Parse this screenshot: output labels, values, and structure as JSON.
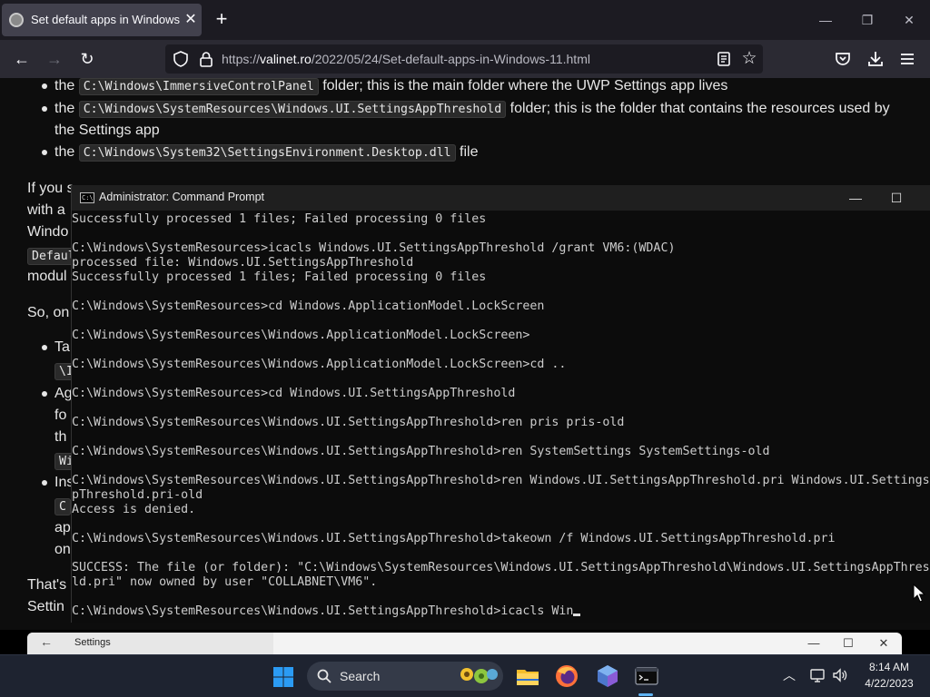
{
  "browser": {
    "tab": {
      "title": "Set default apps in Windows 11",
      "close_glyph": "✕"
    },
    "new_tab_glyph": "+",
    "window_controls": {
      "minimize": "—",
      "restore": "❐",
      "close": "✕"
    },
    "nav": {
      "back": "←",
      "forward": "→",
      "reload": "↻"
    },
    "url": {
      "host": "valinet.ro",
      "prefix": "https://",
      "path": "/2022/05/24/Set-default-apps-in-Windows-11.html"
    },
    "star": "☆"
  },
  "page": {
    "bullets": [
      {
        "pre": "the ",
        "code": "C:\\Windows\\ImmersiveControlPanel",
        "post": " folder; this is the main folder where the UWP Settings app lives"
      },
      {
        "pre": "the ",
        "code": "C:\\Windows\\SystemResources\\Windows.UI.SettingsAppThreshold",
        "post": " folder; this is the folder that contains the resources used by"
      },
      {
        "cont": "the Settings app"
      },
      {
        "pre": "the ",
        "code": "C:\\Windows\\System32\\SettingsEnvironment.Desktop.dll",
        "post": " file"
      }
    ],
    "fragments": {
      "if_you": "If you s",
      "with_a": "with a",
      "windo": "Windo",
      "defaul": "Defaul",
      "modul": "modul",
      "so_on": "So, on",
      "ta": "Ta",
      "code_i": "\\I",
      "ag": "Ag",
      "fo": "fo",
      "th": "th",
      "code_w": "Wi",
      "ins": "Ins",
      "code_c": "C",
      "ap": "ap",
      "on": "on",
      "thats": "That's",
      "settin": "Settin"
    }
  },
  "cmd": {
    "title": "Administrator: Command Prompt",
    "icon_text": "C:\\",
    "window_controls": {
      "minimize": "—",
      "maximize": "☐"
    },
    "lines": [
      "Successfully processed 1 files; Failed processing 0 files",
      "",
      "C:\\Windows\\SystemResources>icacls Windows.UI.SettingsAppThreshold /grant VM6:(WDAC)",
      "processed file: Windows.UI.SettingsAppThreshold",
      "Successfully processed 1 files; Failed processing 0 files",
      "",
      "C:\\Windows\\SystemResources>cd Windows.ApplicationModel.LockScreen",
      "",
      "C:\\Windows\\SystemResources\\Windows.ApplicationModel.LockScreen>",
      "",
      "C:\\Windows\\SystemResources\\Windows.ApplicationModel.LockScreen>cd ..",
      "",
      "C:\\Windows\\SystemResources>cd Windows.UI.SettingsAppThreshold",
      "",
      "C:\\Windows\\SystemResources\\Windows.UI.SettingsAppThreshold>ren pris pris-old",
      "",
      "C:\\Windows\\SystemResources\\Windows.UI.SettingsAppThreshold>ren SystemSettings SystemSettings-old",
      "",
      "C:\\Windows\\SystemResources\\Windows.UI.SettingsAppThreshold>ren Windows.UI.SettingsAppThreshold.pri Windows.UI.SettingsAp",
      "pThreshold.pri-old",
      "Access is denied.",
      "",
      "C:\\Windows\\SystemResources\\Windows.UI.SettingsAppThreshold>takeown /f Windows.UI.SettingsAppThreshold.pri",
      "",
      "SUCCESS: The file (or folder): \"C:\\Windows\\SystemResources\\Windows.UI.SettingsAppThreshold\\Windows.UI.SettingsAppThresho",
      "ld.pri\" now owned by user \"COLLABNET\\VM6\".",
      "",
      "C:\\Windows\\SystemResources\\Windows.UI.SettingsAppThreshold>icacls Win"
    ]
  },
  "settings_window": {
    "title": "Settings",
    "back": "←",
    "controls": {
      "minimize": "—",
      "maximize": "☐",
      "close": "✕"
    }
  },
  "taskbar": {
    "search_label": "Search",
    "tray_chevron": "︿",
    "clock": {
      "time": "8:14 AM",
      "date": "4/22/2023"
    }
  },
  "colors": {
    "accent": "#5fb2f2",
    "windows_blue": "#2b9bf4"
  }
}
